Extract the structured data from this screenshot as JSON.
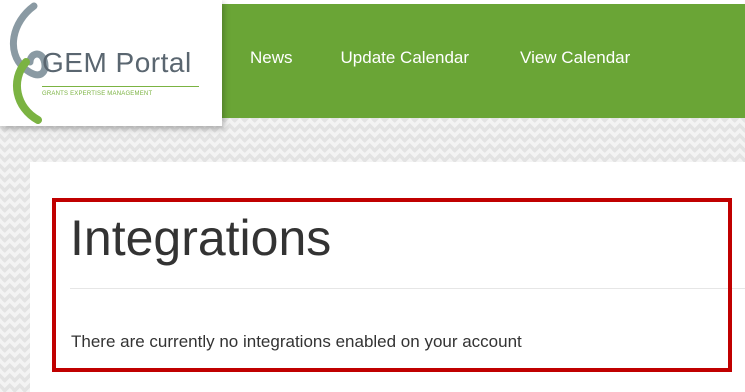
{
  "logo": {
    "title": "GEM Portal",
    "tagline": "GRANTS EXPERTISE MANAGEMENT"
  },
  "nav": {
    "items": [
      {
        "label": "News"
      },
      {
        "label": "Update Calendar"
      },
      {
        "label": "View Calendar"
      }
    ]
  },
  "main": {
    "title": "Integrations",
    "message": "There are currently no integrations enabled on your account"
  },
  "colors": {
    "nav_green": "#6aa536",
    "logo_green": "#7bb342",
    "highlight_red": "#c00000"
  }
}
